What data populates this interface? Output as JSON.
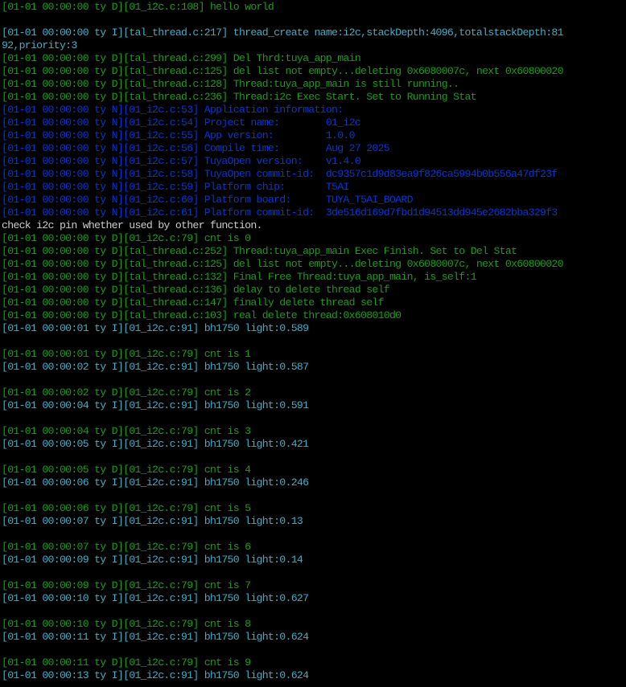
{
  "colors": {
    "green": "#13a10e",
    "cyan": "#3bb0c9",
    "blue": "#0037da",
    "white": "#cccccc",
    "background": "#000000"
  },
  "lines": [
    {
      "text": "[01-01 00:00:00 ty D][01_i2c.c:108] hello world",
      "color": "green"
    },
    {
      "text": "",
      "color": "green"
    },
    {
      "text": "[01-01 00:00:00 ty I][tal_thread.c:217] thread_create name:i2c,stackDepth:4096,totalstackDepth:81",
      "color": "cyan"
    },
    {
      "text": "92,priority:3",
      "color": "cyan"
    },
    {
      "text": "[01-01 00:00:00 ty D][tal_thread.c:299] Del Thrd:tuya_app_main",
      "color": "green"
    },
    {
      "text": "[01-01 00:00:00 ty D][tal_thread.c:125] del list not empty...deleting 0x6080007c, next 0x60800020",
      "color": "green"
    },
    {
      "text": "[01-01 00:00:00 ty D][tal_thread.c:128] Thread:tuya_app_main is still running..",
      "color": "green"
    },
    {
      "text": "[01-01 00:00:00 ty D][tal_thread.c:236] Thread:i2c Exec Start. Set to Running Stat",
      "color": "green"
    },
    {
      "text": "[01-01 00:00:00 ty N][01_i2c.c:53] Application information:",
      "color": "blue"
    },
    {
      "text": "[01-01 00:00:00 ty N][01_i2c.c:54] Project name:        01_i2c",
      "color": "blue"
    },
    {
      "text": "[01-01 00:00:00 ty N][01_i2c.c:55] App version:         1.0.0",
      "color": "blue"
    },
    {
      "text": "[01-01 00:00:00 ty N][01_i2c.c:56] Compile time:        Aug 27 2025",
      "color": "blue"
    },
    {
      "text": "[01-01 00:00:00 ty N][01_i2c.c:57] TuyaOpen version:    v1.4.0",
      "color": "blue"
    },
    {
      "text": "[01-01 00:00:00 ty N][01_i2c.c:58] TuyaOpen commit-id:  dc9357c1d9d83ea9f826ca5994b0b556a47df23f",
      "color": "blue"
    },
    {
      "text": "[01-01 00:00:00 ty N][01_i2c.c:59] Platform chip:       T5AI",
      "color": "blue"
    },
    {
      "text": "[01-01 00:00:00 ty N][01_i2c.c:60] Platform board:      TUYA_T5AI_BOARD",
      "color": "blue"
    },
    {
      "text": "[01-01 00:00:00 ty N][01_i2c.c:61] Platform commit-id:  3de516d169d7fbd1d94513dd945e2682bba329f3",
      "color": "blue"
    },
    {
      "text": "check i2c pin whether used by other function.",
      "color": "white"
    },
    {
      "text": "[01-01 00:00:00 ty D][01_i2c.c:79] cnt is 0",
      "color": "green"
    },
    {
      "text": "[01-01 00:00:00 ty D][tal_thread.c:252] Thread:tuya_app_main Exec Finish. Set to Del Stat",
      "color": "green"
    },
    {
      "text": "[01-01 00:00:00 ty D][tal_thread.c:125] del list not empty...deleting 0x6080007c, next 0x60800020",
      "color": "green"
    },
    {
      "text": "[01-01 00:00:00 ty D][tal_thread.c:132] Final Free Thread:tuya_app_main, is_self:1",
      "color": "green"
    },
    {
      "text": "[01-01 00:00:00 ty D][tal_thread.c:136] delay to delete thread self",
      "color": "green"
    },
    {
      "text": "[01-01 00:00:00 ty D][tal_thread.c:147] finally delete thread self",
      "color": "green"
    },
    {
      "text": "[01-01 00:00:00 ty D][tal_thread.c:103] real delete thread:0x608010d0",
      "color": "green"
    },
    {
      "text": "[01-01 00:00:01 ty I][01_i2c.c:91] bh1750 light:0.589",
      "color": "cyan"
    },
    {
      "text": "",
      "color": "green"
    },
    {
      "text": "[01-01 00:00:01 ty D][01_i2c.c:79] cnt is 1",
      "color": "green"
    },
    {
      "text": "[01-01 00:00:02 ty I][01_i2c.c:91] bh1750 light:0.587",
      "color": "cyan"
    },
    {
      "text": "",
      "color": "green"
    },
    {
      "text": "[01-01 00:00:02 ty D][01_i2c.c:79] cnt is 2",
      "color": "green"
    },
    {
      "text": "[01-01 00:00:04 ty I][01_i2c.c:91] bh1750 light:0.591",
      "color": "cyan"
    },
    {
      "text": "",
      "color": "green"
    },
    {
      "text": "[01-01 00:00:04 ty D][01_i2c.c:79] cnt is 3",
      "color": "green"
    },
    {
      "text": "[01-01 00:00:05 ty I][01_i2c.c:91] bh1750 light:0.421",
      "color": "cyan"
    },
    {
      "text": "",
      "color": "green"
    },
    {
      "text": "[01-01 00:00:05 ty D][01_i2c.c:79] cnt is 4",
      "color": "green"
    },
    {
      "text": "[01-01 00:00:06 ty I][01_i2c.c:91] bh1750 light:0.246",
      "color": "cyan"
    },
    {
      "text": "",
      "color": "green"
    },
    {
      "text": "[01-01 00:00:06 ty D][01_i2c.c:79] cnt is 5",
      "color": "green"
    },
    {
      "text": "[01-01 00:00:07 ty I][01_i2c.c:91] bh1750 light:0.13",
      "color": "cyan"
    },
    {
      "text": "",
      "color": "green"
    },
    {
      "text": "[01-01 00:00:07 ty D][01_i2c.c:79] cnt is 6",
      "color": "green"
    },
    {
      "text": "[01-01 00:00:09 ty I][01_i2c.c:91] bh1750 light:0.14",
      "color": "cyan"
    },
    {
      "text": "",
      "color": "green"
    },
    {
      "text": "[01-01 00:00:09 ty D][01_i2c.c:79] cnt is 7",
      "color": "green"
    },
    {
      "text": "[01-01 00:00:10 ty I][01_i2c.c:91] bh1750 light:0.627",
      "color": "cyan"
    },
    {
      "text": "",
      "color": "green"
    },
    {
      "text": "[01-01 00:00:10 ty D][01_i2c.c:79] cnt is 8",
      "color": "green"
    },
    {
      "text": "[01-01 00:00:11 ty I][01_i2c.c:91] bh1750 light:0.624",
      "color": "cyan"
    },
    {
      "text": "",
      "color": "green"
    },
    {
      "text": "[01-01 00:00:11 ty D][01_i2c.c:79] cnt is 9",
      "color": "green"
    },
    {
      "text": "[01-01 00:00:13 ty I][01_i2c.c:91] bh1750 light:0.624",
      "color": "cyan"
    }
  ]
}
